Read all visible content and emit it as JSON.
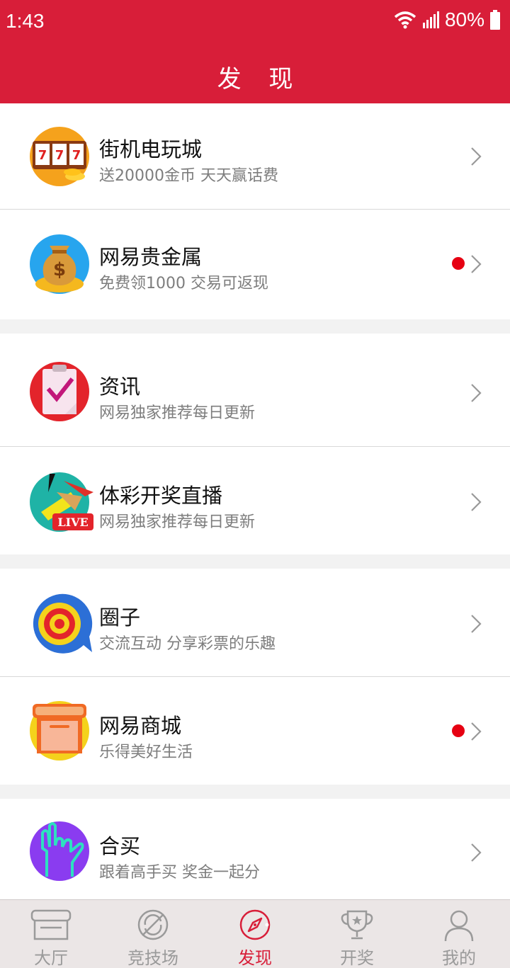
{
  "status_bar": {
    "time": "1:43",
    "battery": "80%"
  },
  "header": {
    "title": "发 现"
  },
  "items": [
    {
      "title": "街机电玩城",
      "subtitle": "送20000金币 天天赢话费",
      "icon": "slot-machine-icon",
      "badge": false
    },
    {
      "title": "网易贵金属",
      "subtitle": "免费领1000 交易可返现",
      "icon": "money-bag-icon",
      "badge": true
    },
    {
      "title": "资讯",
      "subtitle": "网易独家推荐每日更新",
      "icon": "clipboard-check-icon",
      "badge": false
    },
    {
      "title": "体彩开奖直播",
      "subtitle": "网易独家推荐每日更新",
      "icon": "live-broadcast-icon",
      "badge": false,
      "icon_text": "LIVE"
    },
    {
      "title": "圈子",
      "subtitle": "交流互动 分享彩票的乐趣",
      "icon": "target-chat-icon",
      "badge": false
    },
    {
      "title": "网易商城",
      "subtitle": "乐得美好生活",
      "icon": "shop-icon",
      "badge": true
    },
    {
      "title": "合买",
      "subtitle": "跟着高手买 奖金一起分",
      "icon": "hand-gesture-icon",
      "badge": false
    }
  ],
  "tabs": [
    {
      "label": "大厅",
      "icon": "storefront-icon",
      "active": false
    },
    {
      "label": "竞技场",
      "icon": "ball-icon",
      "active": false
    },
    {
      "label": "发现",
      "icon": "compass-icon",
      "active": true
    },
    {
      "label": "开奖",
      "icon": "trophy-icon",
      "active": false
    },
    {
      "label": "我的",
      "icon": "user-icon",
      "active": false
    }
  ],
  "colors": {
    "brand_red": "#d81e39",
    "badge_red": "#e60012"
  }
}
